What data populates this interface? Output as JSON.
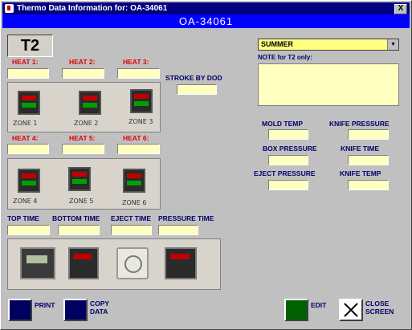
{
  "window": {
    "title": "Thermo Data Information for: OA-34061",
    "close": "X"
  },
  "header": "OA-34061",
  "station": "T2",
  "heat_labels": [
    "HEAT 1:",
    "HEAT 2:",
    "HEAT 3:",
    "HEAT 4:",
    "HEAT 5:",
    "HEAT 6:"
  ],
  "zones_top": [
    "ZONE 1",
    "ZONE 2",
    "ZONE 3"
  ],
  "zones_bottom": [
    "ZONE 4",
    "ZONE 5",
    "ZONE 6"
  ],
  "strokes_label": "STROKE BY DOD",
  "time_labels": [
    "TOP TIME",
    "BOTTOM TIME",
    "EJECT TIME",
    "PRESSURE TIME"
  ],
  "season": {
    "selected": "SUMMER"
  },
  "note_label": "NOTE for T2 only:",
  "params": {
    "mold_temp": "MOLD TEMP",
    "knife_pressure": "KNIFE PRESSURE",
    "box_pressure": "BOX PRESSURE",
    "knife_time": "KNIFE TIME",
    "eject_pressure": "EJECT PRESSURE",
    "knife_temp": "KNIFE TEMP"
  },
  "buttons": {
    "print": "PRINT",
    "copy_1": "COPY",
    "copy_2": "DATA",
    "edit": "EDIT",
    "close_1": "CLOSE",
    "close_2": "SCREEN"
  },
  "colors": {
    "title_bar": "#000080",
    "header": "#0000ff",
    "field": "#ffffc0",
    "edit_button": "#006000",
    "print_button": "#000060"
  }
}
